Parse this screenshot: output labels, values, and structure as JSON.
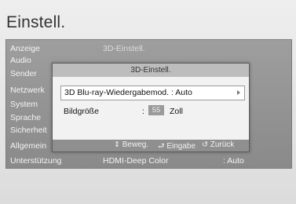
{
  "app": {
    "title": "Einstell."
  },
  "sidebar": {
    "items": [
      {
        "label": "Anzeige"
      },
      {
        "label": "Audio"
      },
      {
        "label": "Sender"
      },
      {
        "label": "Netzwerk"
      },
      {
        "label": "System"
      },
      {
        "label": "Sprache"
      },
      {
        "label": "Sicherheit"
      },
      {
        "label": "Allgemein"
      },
      {
        "label": "Unterstützung"
      }
    ]
  },
  "main": {
    "header": "3D-Einstell.",
    "rows": [
      {
        "label": "HDMI-Deep Color",
        "value": ": Auto"
      }
    ]
  },
  "dialog": {
    "title": "3D-Einstell.",
    "options": [
      {
        "label": "3D Blu-ray-Wiedergabemod. : Auto",
        "selected": true
      }
    ],
    "screen_size": {
      "label": "Bildgröße",
      "separator": ":",
      "value": "55",
      "unit": "Zoll"
    },
    "footer": {
      "move": {
        "icon": "up-down-arrows-icon",
        "label": "Beweg."
      },
      "enter": {
        "icon": "enter-icon",
        "label": "Eingabe"
      },
      "back": {
        "icon": "return-icon",
        "label": "Zurück"
      }
    }
  },
  "colors": {
    "panel": "#939393",
    "dialog_title_bar": "#bdbdbd",
    "dialog_footer": "#8f8f8f",
    "selected_row": "#ffffff"
  }
}
